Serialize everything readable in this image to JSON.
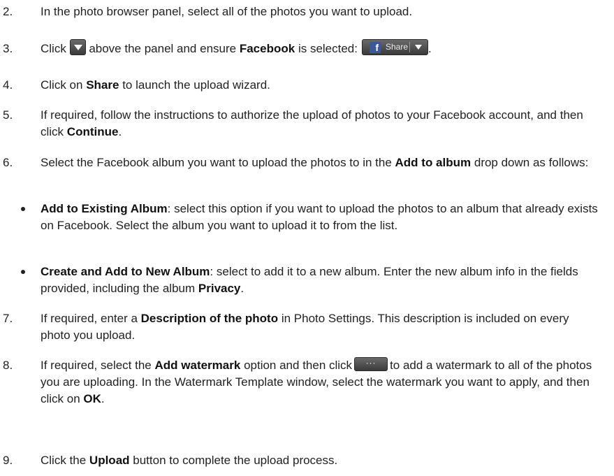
{
  "steps": [
    {
      "number": "2.",
      "text": "In the photo browser panel, select all of the photos you want to upload."
    },
    {
      "number": "3.",
      "pre": "Click",
      "mid1": "above the panel and ensure",
      "bold": "Facebook",
      "mid2": "is selected:",
      "post": "."
    },
    {
      "number": "4.",
      "pre": "Click on",
      "bold": "Share",
      "post": "to launch the upload wizard."
    },
    {
      "number": "5.",
      "pre": "If required, follow the instructions to authorize the upload of photos to your Facebook account, and then click",
      "bold": "Continue",
      "post": "."
    },
    {
      "number": "6.",
      "pre": "Select the Facebook album you want to upload the photos to in the",
      "bold": "Add to album",
      "post": "drop down as follows:"
    },
    {
      "number": "7.",
      "pre": "If required, enter a",
      "bold": "Description of the photo",
      "post": "in Photo Settings. This description is included on every photo you upload."
    },
    {
      "number": "8.",
      "pre": "If required, select the",
      "bold": "Add watermark",
      "mid": "option and then click",
      "post": "to add a watermark to all of the photos you are uploading. In the Watermark Template window, select the watermark you want to apply, and then click on",
      "bold2": "OK",
      "end": "."
    },
    {
      "number": "9.",
      "pre": "Click the",
      "bold": "Upload",
      "post": "button to complete the upload process."
    }
  ],
  "bullets": [
    {
      "bold": "Add to Existing Album",
      "text": ": select this option if you want to upload the photos to an album that already exists on Facebook. Select the album you want to upload it to from the list."
    },
    {
      "bold": "Create and Add to New Album",
      "text": ": select to add it to a new album. Enter the new album info in the fields provided, including the album",
      "bold2": "Privacy",
      "end": "."
    }
  ],
  "buttons": {
    "share_label": "Share",
    "facebook_glyph": "f",
    "more_glyph": "···"
  },
  "icons": {
    "dropdown": "dropdown-arrow-icon",
    "facebook": "facebook-icon",
    "more": "ellipsis-icon"
  },
  "colors": {
    "button_bg": "#4a4a4a",
    "facebook_blue": "#3b5998"
  }
}
